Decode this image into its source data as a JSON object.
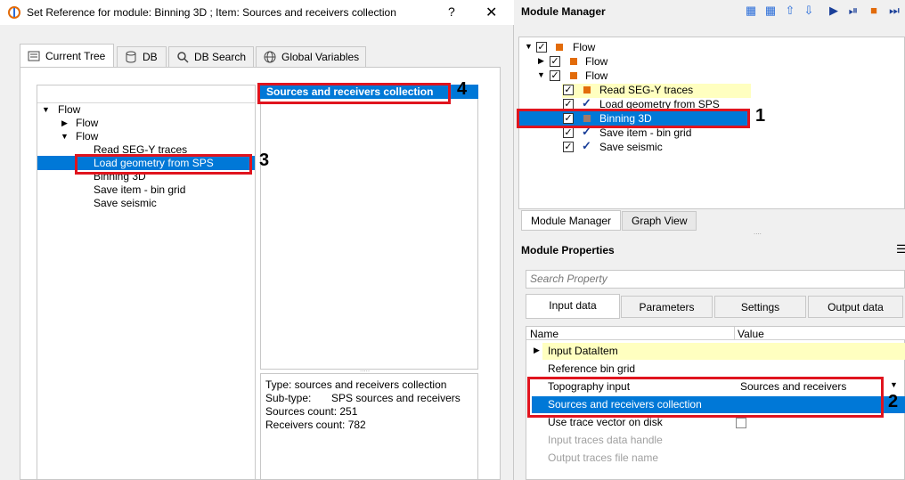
{
  "dialog": {
    "title": "Set Reference for module: Binning 3D ; Item: Sources and receivers collection",
    "help_label": "?",
    "close_label": "✕",
    "tabs": [
      {
        "label": "Current Tree",
        "icon": "tree-icon"
      },
      {
        "label": "DB",
        "icon": "database-icon"
      },
      {
        "label": "DB Search",
        "icon": "search-icon"
      },
      {
        "label": "Global Variables",
        "icon": "globe-icon"
      }
    ],
    "tree": {
      "root": "Flow",
      "children": [
        "Flow",
        "Flow"
      ],
      "items": [
        "Read SEG-Y traces",
        "Load geometry from SPS",
        "Binning 3D",
        "Save item - bin grid",
        "Save seismic"
      ]
    },
    "middle_list": {
      "selected": "Sources and receivers collection"
    },
    "info": {
      "type": "Type: sources and receivers collection",
      "subtype_label": "Sub-type:",
      "subtype_value": "SPS sources and receivers",
      "sources": "Sources count:  251",
      "receivers": "Receivers count: 782"
    }
  },
  "module_manager": {
    "title": "Module Manager",
    "tree": {
      "rows": [
        "Flow",
        "Flow",
        "Flow",
        "Read SEG-Y traces",
        "Load geometry from SPS",
        "Binning 3D",
        "Save item - bin grid",
        "Save seismic"
      ]
    },
    "tabs": [
      "Module Manager",
      "Graph View"
    ]
  },
  "module_properties": {
    "title": "Module Properties",
    "search_placeholder": "Search Property",
    "tabs": [
      "Input data",
      "Parameters",
      "Settings",
      "Output data"
    ],
    "columns": [
      "Name",
      "Value"
    ],
    "rows": [
      {
        "name": "Input DataItem",
        "value": ""
      },
      {
        "name": "Reference bin grid",
        "value": ""
      },
      {
        "name": "Topography input",
        "value": "Sources and receivers"
      },
      {
        "name": "Sources and receivers collection",
        "value": ""
      },
      {
        "name": "Use trace vector on disk",
        "value": ""
      },
      {
        "name": "Input traces data handle",
        "value": ""
      },
      {
        "name": "Output traces file name",
        "value": ""
      }
    ]
  },
  "markers": [
    "1",
    "2",
    "3",
    "4"
  ],
  "colors": {
    "selection": "#0078d7",
    "highlight_yellow": "#ffffc0",
    "annotation_red": "#e0141e",
    "orange": "#e26b0a"
  }
}
